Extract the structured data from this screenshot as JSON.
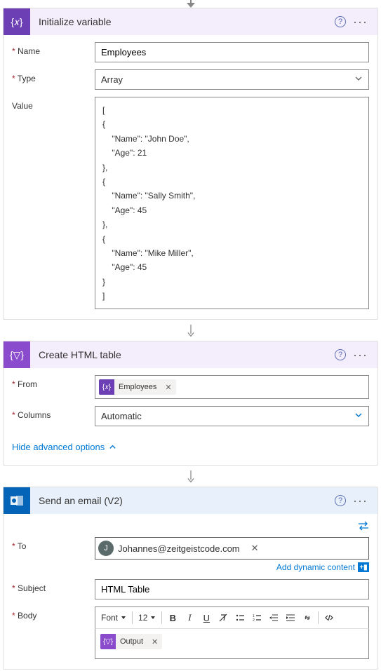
{
  "step1": {
    "title": "Initialize variable",
    "nameLabel": "Name",
    "nameValue": "Employees",
    "typeLabel": "Type",
    "typeValue": "Array",
    "valueLabel": "Value",
    "valueJson": "[\n{\n    \"Name\": \"John Doe\",\n    \"Age\": 21\n},\n{\n    \"Name\": \"Sally Smith\",\n    \"Age\": 45\n},\n{\n    \"Name\": \"Mike Miller\",\n    \"Age\": 45\n}\n]"
  },
  "step2": {
    "title": "Create HTML table",
    "fromLabel": "From",
    "fromToken": "Employees",
    "columnsLabel": "Columns",
    "columnsValue": "Automatic",
    "advOptions": "Hide advanced options"
  },
  "step3": {
    "title": "Send an email (V2)",
    "toLabel": "To",
    "toAvatar": "J",
    "toValue": "Johannes@zeitgeistcode.com",
    "dynContent": "Add dynamic content",
    "subjectLabel": "Subject",
    "subjectValue": "HTML Table",
    "bodyLabel": "Body",
    "fontSel": "Font",
    "sizeSel": "12",
    "outputToken": "Output"
  },
  "icons": {
    "var": "{𝑥}",
    "table": "{▽}"
  }
}
